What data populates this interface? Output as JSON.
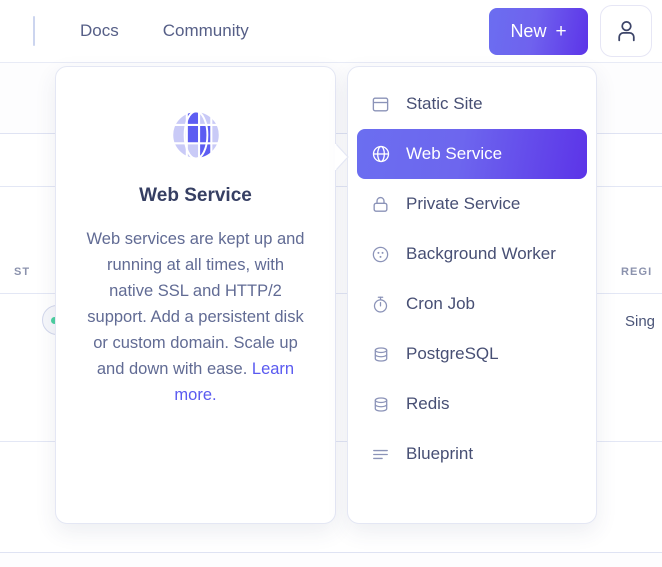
{
  "header": {
    "nav_links": [
      {
        "label": "Docs",
        "name": "nav-link-docs"
      },
      {
        "label": "Community",
        "name": "nav-link-community"
      }
    ],
    "new_button": {
      "label": "New",
      "plus": "+"
    },
    "avatar": {
      "icon": "user-icon"
    }
  },
  "background": {
    "columns": [
      {
        "label": "ST",
        "full": "STATUS"
      },
      {
        "label": "REGI",
        "full": "REGION"
      }
    ],
    "cells": [
      {
        "label": "Sing",
        "full": "Singapore"
      }
    ],
    "status_color": "#4bd1a0"
  },
  "info_panel": {
    "icon": "globe-icon",
    "title": "Web Service",
    "description": "Web services are kept up and running at all times, with native SSL and HTTP/2 support. Add a persistent disk or custom domain. Scale up and down with ease. ",
    "link_label": "Learn more."
  },
  "menu": {
    "items": [
      {
        "label": "Static Site",
        "icon": "browser-window-icon",
        "name": "menu-item-static-site",
        "active": false
      },
      {
        "label": "Web Service",
        "icon": "globe-icon",
        "name": "menu-item-web-service",
        "active": true
      },
      {
        "label": "Private Service",
        "icon": "lock-icon",
        "name": "menu-item-private-service",
        "active": false
      },
      {
        "label": "Background Worker",
        "icon": "worker-dots-icon",
        "name": "menu-item-background-worker",
        "active": false
      },
      {
        "label": "Cron Job",
        "icon": "stopwatch-icon",
        "name": "menu-item-cron-job",
        "active": false
      },
      {
        "label": "PostgreSQL",
        "icon": "database-icon",
        "name": "menu-item-postgresql",
        "active": false
      },
      {
        "label": "Redis",
        "icon": "database-icon",
        "name": "menu-item-redis",
        "active": false
      },
      {
        "label": "Blueprint",
        "icon": "lines-icon",
        "name": "menu-item-blueprint",
        "active": false
      }
    ]
  },
  "colors": {
    "accent_start": "#6b6ef0",
    "accent_end": "#5c34e8",
    "link": "#5a5af0",
    "text": "#474f74",
    "muted": "#616b94",
    "status_green": "#4bd1a0"
  }
}
